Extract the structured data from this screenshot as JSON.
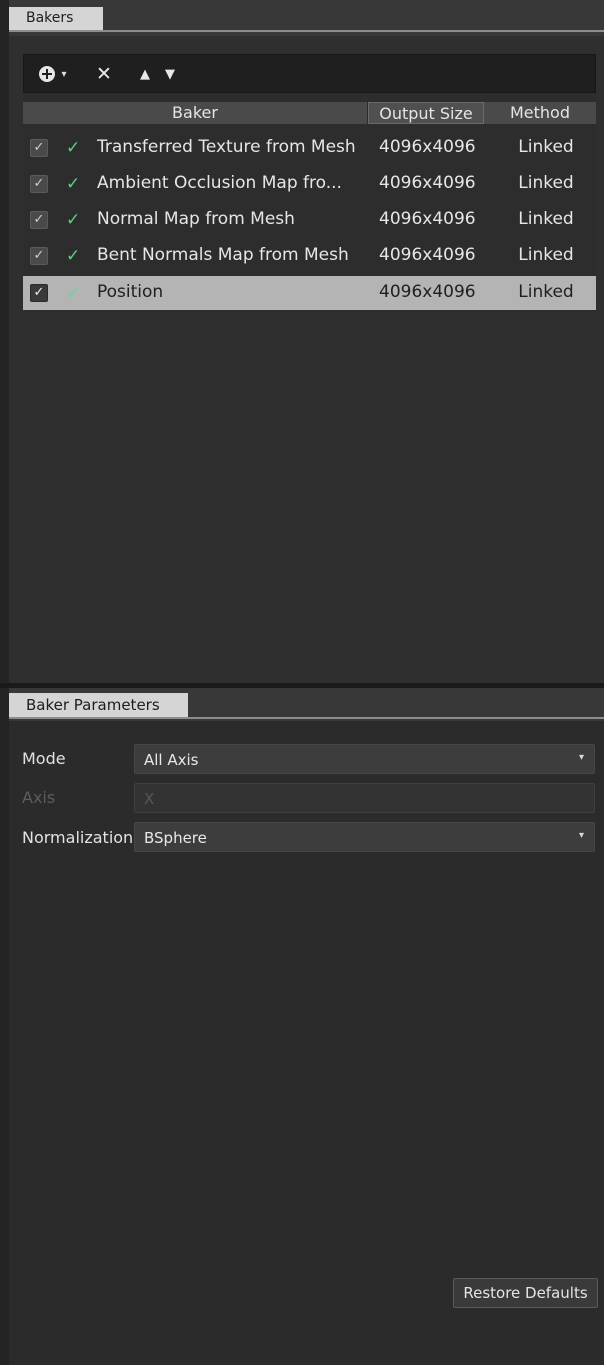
{
  "bakers_panel": {
    "tab_label": "Bakers",
    "toolbar": {
      "add_caret": "▾",
      "delete_glyph": "✕",
      "up_glyph": "▲",
      "down_glyph": "▼"
    },
    "columns": [
      "Baker",
      "Output Size",
      "Method"
    ],
    "rows": [
      {
        "checked": true,
        "status": "ok",
        "name": "Transferred Texture from Mesh",
        "size": "4096x4096",
        "method": "Linked",
        "selected": false
      },
      {
        "checked": true,
        "status": "ok",
        "name": "Ambient Occlusion Map fro...",
        "size": "4096x4096",
        "method": "Linked",
        "selected": false
      },
      {
        "checked": true,
        "status": "ok",
        "name": "Normal Map from Mesh",
        "size": "4096x4096",
        "method": "Linked",
        "selected": false
      },
      {
        "checked": true,
        "status": "ok",
        "name": "Bent Normals Map from Mesh",
        "size": "4096x4096",
        "method": "Linked",
        "selected": false
      },
      {
        "checked": true,
        "status": "ok",
        "name": "Position",
        "size": "4096x4096",
        "method": "Linked",
        "selected": true
      }
    ],
    "check_glyph": "✓",
    "ok_glyph": "✓"
  },
  "params_panel": {
    "tab_label": "Baker Parameters",
    "params": {
      "mode_label": "Mode",
      "mode_value": "All Axis",
      "axis_label": "Axis",
      "axis_value": "X",
      "normalization_label": "Normalization",
      "normalization_value": "BSphere",
      "dropdown_caret": "▾"
    },
    "restore_label": "Restore Defaults"
  },
  "colors": {
    "background": "#2b2b2b",
    "tab_active": "#d5d5d5",
    "selected_row": "#b4b4b4",
    "ok_check": "#5ccf87"
  }
}
